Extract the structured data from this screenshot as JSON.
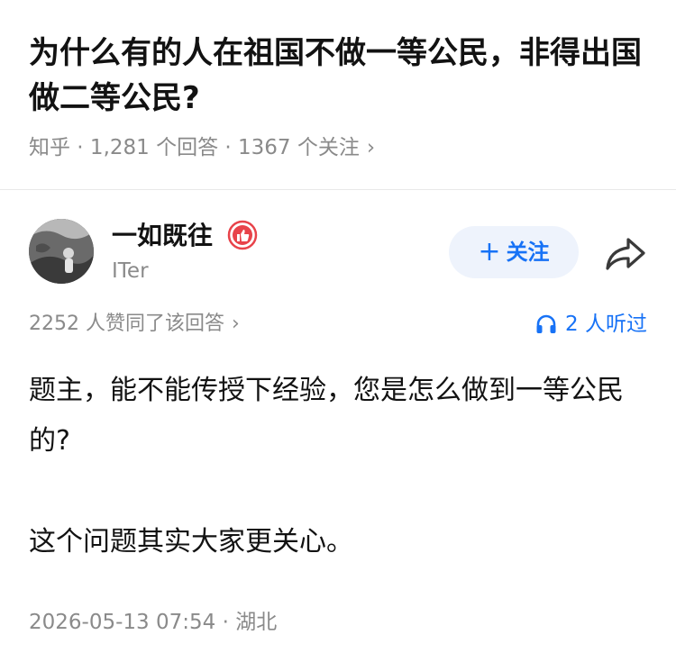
{
  "question": {
    "title": "为什么有的人在祖国不做一等公民，非得出国做二等公民?",
    "meta": "知乎 · 1,281 个回答 · 1367 个关注",
    "meta_chevron": "›"
  },
  "author": {
    "name": "一如既往",
    "bio": "ITer",
    "badge_icon": "thumbs-up-badge",
    "badge_color": "#e8434a",
    "follow_label": "关注",
    "follow_icon": "+",
    "share_icon": "share-arrow"
  },
  "answer": {
    "upvotes": "2252 人赞同了该回答",
    "upvotes_chevron": "›",
    "listeners": "2 人听过",
    "listen_icon": "headphones",
    "paragraphs": [
      "题主，能不能传授下经验，您是怎么做到一等公民的?",
      "这个问题其实大家更关心。"
    ],
    "timestamp": "2026-05-13 07:54 · 湖北"
  },
  "colors": {
    "accent": "#1772f6",
    "follow_bg": "#eef3fc",
    "muted_text": "#8a8a8a",
    "main_text": "#121212"
  }
}
